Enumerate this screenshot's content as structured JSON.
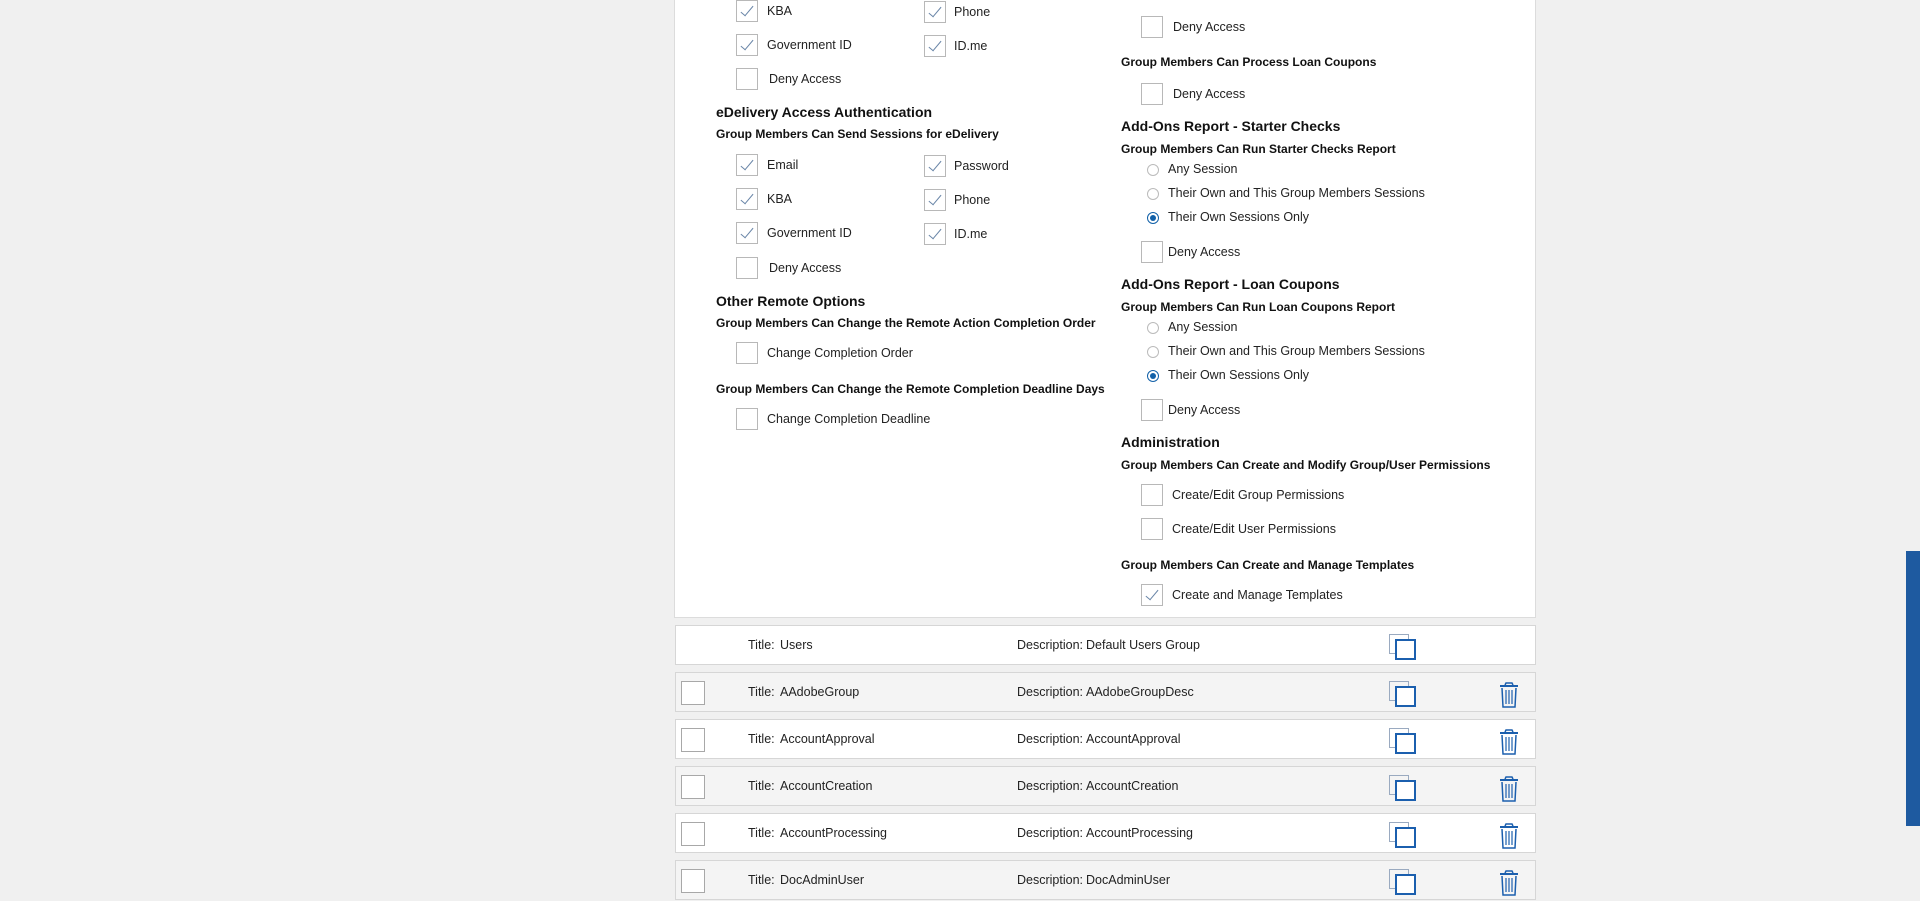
{
  "left": {
    "top_checks": [
      {
        "label": "KBA",
        "checked": true
      },
      {
        "label": "Phone",
        "checked": true
      },
      {
        "label": "Government ID",
        "checked": true
      },
      {
        "label": "ID.me",
        "checked": true
      },
      {
        "label": "Deny Access",
        "checked": false
      }
    ],
    "edelivery": {
      "title": "eDelivery Access Authentication",
      "subtitle": "Group Members Can Send Sessions for eDelivery",
      "checks": [
        {
          "label": "Email",
          "checked": true
        },
        {
          "label": "Password",
          "checked": true
        },
        {
          "label": "KBA",
          "checked": true
        },
        {
          "label": "Phone",
          "checked": true
        },
        {
          "label": "Government ID",
          "checked": true
        },
        {
          "label": "ID.me",
          "checked": true
        },
        {
          "label": "Deny Access",
          "checked": false
        }
      ]
    },
    "other": {
      "title": "Other Remote Options",
      "sub1": "Group Members Can Change the Remote Action Completion Order",
      "check1": "Change Completion Order",
      "sub2": "Group Members Can Change the Remote Completion Deadline Days",
      "check2": "Change Completion Deadline"
    }
  },
  "right": {
    "deny_top": "Deny Access",
    "loan_coupons_sub": "Group Members Can Process Loan Coupons",
    "deny_loan": "Deny Access",
    "starter": {
      "title": "Add-Ons Report - Starter Checks",
      "subtitle": "Group Members Can Run Starter Checks Report",
      "options": [
        "Any Session",
        "Their Own and This Group Members Sessions",
        "Their Own Sessions Only"
      ],
      "selected": 2,
      "deny": "Deny Access"
    },
    "loan": {
      "title": "Add-Ons Report - Loan Coupons",
      "subtitle": "Group Members Can Run Loan Coupons Report",
      "options": [
        "Any Session",
        "Their Own and This Group Members Sessions",
        "Their Own Sessions Only"
      ],
      "selected": 2,
      "deny": "Deny Access"
    },
    "admin": {
      "title": "Administration",
      "subtitle": "Group Members Can Create and Modify Group/User Permissions",
      "check1": "Create/Edit Group Permissions",
      "check2": "Create/Edit User Permissions",
      "templates_sub": "Group Members Can Create and Manage Templates",
      "templates_check": "Create and Manage Templates",
      "templates_checked": true
    }
  },
  "groups": {
    "title_prefix": "Title:",
    "desc_prefix": "Description:",
    "rows": [
      {
        "title": "Users",
        "description": "Default Users Group",
        "selectable": false,
        "deletable": false
      },
      {
        "title": "AAdobeGroup",
        "description": "AAdobeGroupDesc",
        "selectable": true,
        "deletable": true
      },
      {
        "title": "AccountApproval",
        "description": "AccountApproval",
        "selectable": true,
        "deletable": true
      },
      {
        "title": "AccountCreation",
        "description": "AccountCreation",
        "selectable": true,
        "deletable": true
      },
      {
        "title": "AccountProcessing",
        "description": "AccountProcessing",
        "selectable": true,
        "deletable": true
      },
      {
        "title": "DocAdminUser",
        "description": "DocAdminUser",
        "selectable": true,
        "deletable": true
      }
    ]
  },
  "colors": {
    "accent": "#1160a8",
    "icon_blue": "#1b5fae",
    "scrollbar": "#1e5aa0"
  }
}
